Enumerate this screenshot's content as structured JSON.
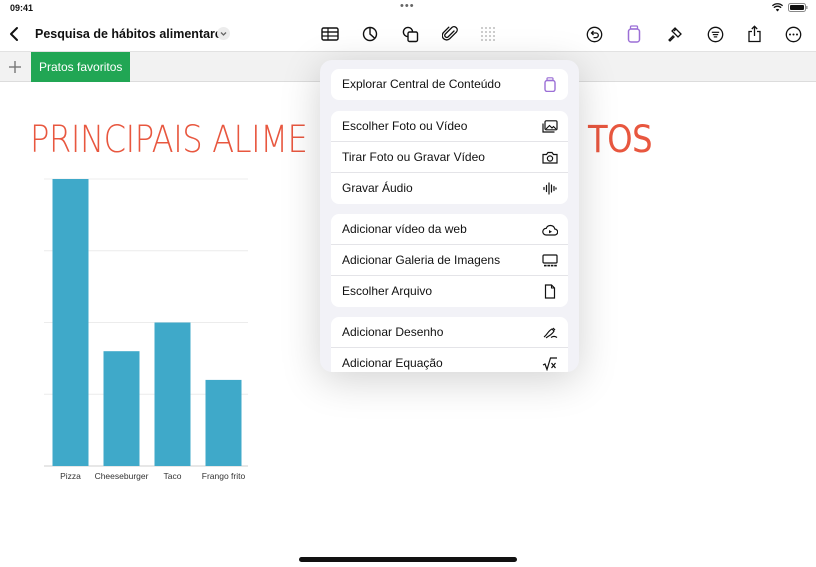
{
  "status_bar": {
    "time": "09:41",
    "center_dots": "•••"
  },
  "toolbar": {
    "title": "Pesquisa de hábitos alimentares",
    "icons": [
      "table-icon",
      "chart-icon",
      "shape-icon",
      "paperclip-icon",
      "grid-icon",
      "undo-icon",
      "content-library-icon",
      "format-brush-icon",
      "menu-lines-icon",
      "share-icon",
      "more-icon"
    ]
  },
  "sheet_tabs": {
    "active": "Pratos favoritos"
  },
  "canvas": {
    "title_left": "PRINCIPAIS ALIME",
    "title_right": "TOS"
  },
  "chart_data": {
    "type": "bar",
    "categories": [
      "Pizza",
      "Cheeseburger",
      "Taco",
      "Frango frito"
    ],
    "values": [
      100,
      40,
      50,
      30
    ],
    "ylim": [
      0,
      100
    ],
    "grid": true,
    "color": "#3fa9c9"
  },
  "menu": {
    "groups": [
      [
        {
          "label": "Explorar Central de Conteúdo",
          "icon": "content-hub-icon"
        }
      ],
      [
        {
          "label": "Escolher Foto ou Vídeo",
          "icon": "photo-library-icon"
        },
        {
          "label": "Tirar Foto ou Gravar Vídeo",
          "icon": "camera-icon"
        },
        {
          "label": "Gravar Áudio",
          "icon": "waveform-icon"
        }
      ],
      [
        {
          "label": "Adicionar vídeo da web",
          "icon": "cloud-play-icon"
        },
        {
          "label": "Adicionar Galeria de Imagens",
          "icon": "image-gallery-icon"
        },
        {
          "label": "Escolher Arquivo",
          "icon": "document-icon"
        }
      ],
      [
        {
          "label": "Adicionar Desenho",
          "icon": "drawing-icon"
        },
        {
          "label": "Adicionar Equação",
          "icon": "equation-icon"
        }
      ]
    ]
  },
  "colors": {
    "accent": "#21a654",
    "title": "#e8573f",
    "content_icon": "#9b6fd6"
  }
}
